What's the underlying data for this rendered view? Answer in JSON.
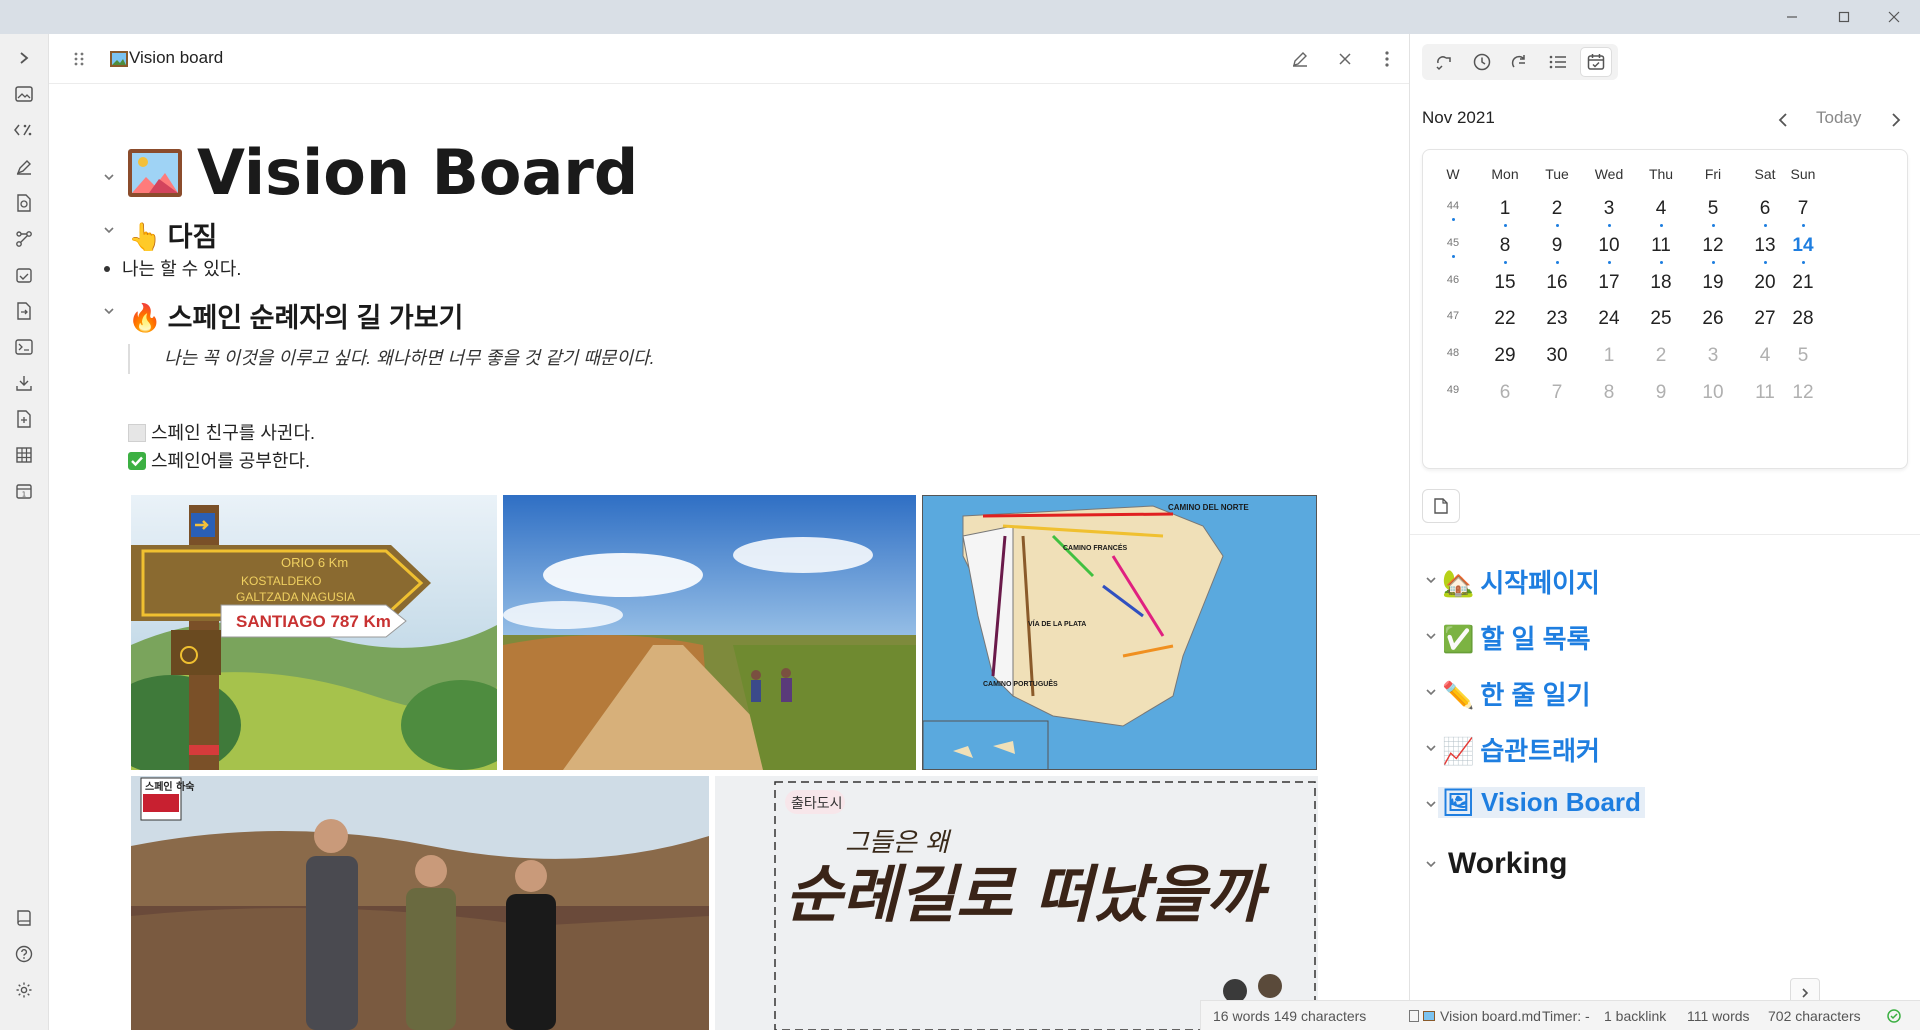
{
  "window": {
    "minimize": "—",
    "maximize": "□",
    "close": "✕"
  },
  "tab": {
    "title": "Vision board",
    "icon": "picture-emoji"
  },
  "doc": {
    "title": "Vision Board",
    "title_icon": "🖼",
    "h2_1": "다짐",
    "h2_1_icon": "👆",
    "bullet_1": "나는 할 수 있다.",
    "h2_2": "스페인 순례자의 길 가보기",
    "h2_2_icon": "🔥",
    "quote": "나는 꼭 이것을 이루고 싶다. 왜나하면 너무 좋을 것 같기 때문이다.",
    "task_1": "스페인 친구를 사귄다.",
    "task_2": "스페인어를 공부한다.",
    "task_1_checked": false,
    "task_2_checked": true,
    "image_sign_text": "SANTIAGO 787 Km",
    "sign_lines": [
      "ORIO 6 Km",
      "KOSTALDEKO",
      "GALTZADA NAGUSIA"
    ],
    "map_labels": [
      "CAMINO DEL NORTE",
      "CAMINO FRANCÉS",
      "VÍA DE LA PLATA",
      "CAMINO PORTUGUÊS"
    ],
    "poster_badge": "스페인 하숙",
    "poster_tag": "출타도시",
    "poster_small": "그들은 왜",
    "poster_big": "순례길로 떠났을까"
  },
  "calendar": {
    "month": "Nov 2021",
    "today_label": "Today",
    "headers": [
      "W",
      "Mon",
      "Tue",
      "Wed",
      "Thu",
      "Fri",
      "Sat",
      "Sun"
    ],
    "weeks": [
      {
        "w": "44",
        "days": [
          "1",
          "2",
          "3",
          "4",
          "5",
          "6",
          "7"
        ]
      },
      {
        "w": "45",
        "days": [
          "8",
          "9",
          "10",
          "11",
          "12",
          "13",
          "14"
        ]
      },
      {
        "w": "46",
        "days": [
          "15",
          "16",
          "17",
          "18",
          "19",
          "20",
          "21"
        ]
      },
      {
        "w": "47",
        "days": [
          "22",
          "23",
          "24",
          "25",
          "26",
          "27",
          "28"
        ]
      },
      {
        "w": "48",
        "days": [
          "29",
          "30",
          "1",
          "2",
          "3",
          "4",
          "5"
        ]
      },
      {
        "w": "49",
        "days": [
          "6",
          "7",
          "8",
          "9",
          "10",
          "11",
          "12"
        ]
      }
    ],
    "accent": "#1e7ee0"
  },
  "outline": [
    {
      "icon": "🏡",
      "label": "시작페이지"
    },
    {
      "icon": "✅",
      "label": "할 일 목록"
    },
    {
      "icon": "✏️",
      "label": "한 줄 일기"
    },
    {
      "icon": "📈",
      "label": "습관트래커"
    },
    {
      "icon": "🖼",
      "label": "Vision Board"
    },
    {
      "icon": "",
      "label": "Working"
    }
  ],
  "status": {
    "words_chars": "16 words 149 characters",
    "file": "Vision board.md",
    "timer": "Timer: -",
    "backlinks": "1 backlink",
    "words": "111 words",
    "chars": "702 characters"
  }
}
